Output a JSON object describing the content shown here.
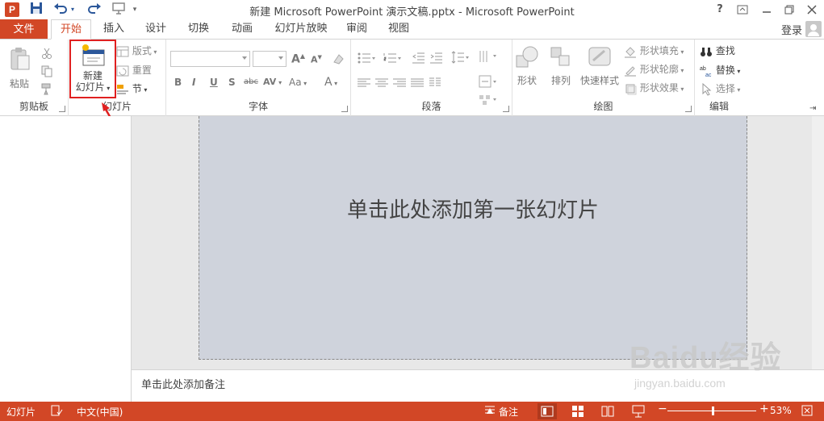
{
  "titlebar": {
    "title": "新建 Microsoft PowerPoint 演示文稿.pptx - Microsoft PowerPoint",
    "help": "?",
    "logo_letter": "P"
  },
  "tabs": {
    "file": "文件",
    "items": [
      "开始",
      "插入",
      "设计",
      "切换",
      "动画",
      "幻灯片放映",
      "审阅",
      "视图"
    ],
    "login": "登录"
  },
  "ribbon": {
    "clipboard": {
      "label": "剪贴板",
      "paste": "粘贴"
    },
    "slides": {
      "label": "幻灯片",
      "new_slide_line1": "新建",
      "new_slide_line2": "幻灯片",
      "layout": "版式",
      "reset": "重置",
      "section": "节"
    },
    "font": {
      "label": "字体",
      "bold": "B",
      "italic": "I",
      "underline": "U",
      "shadow": "S",
      "strike": "abc",
      "spacing": "AV",
      "case": "Aa",
      "color": "A",
      "grow": "A",
      "shrink": "A"
    },
    "paragraph": {
      "label": "段落"
    },
    "drawing": {
      "label": "绘图",
      "shapes": "形状",
      "arrange": "排列",
      "quick_styles": "快速样式",
      "shape_fill": "形状填充",
      "shape_outline": "形状轮廓",
      "shape_effects": "形状效果"
    },
    "editing": {
      "label": "编辑",
      "find": "查找",
      "replace": "替换",
      "select": "选择"
    }
  },
  "slide": {
    "title_placeholder": "单击此处添加第一张幻灯片"
  },
  "notes": {
    "placeholder": "单击此处添加备注"
  },
  "watermark": {
    "brand": "Baidu经验",
    "url": "jingyan.baidu.com"
  },
  "statusbar": {
    "slide_label": "幻灯片",
    "language": "中文(中国)",
    "notes": "备注",
    "zoom": "53%",
    "zoom_level": 0.53
  },
  "colors": {
    "accent": "#d24726",
    "slide_bg": "#cfd3dc",
    "highlight": "#e02020"
  }
}
